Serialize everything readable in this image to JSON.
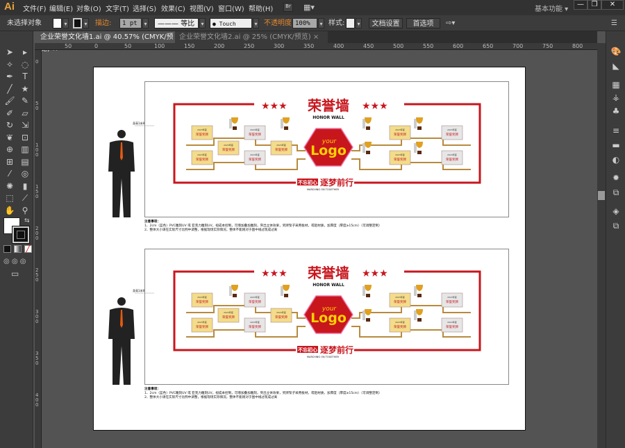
{
  "app": {
    "logo": "Ai",
    "menus": [
      "文件(F)",
      "编辑(E)",
      "对象(O)",
      "文字(T)",
      "选择(S)",
      "效果(C)",
      "视图(V)",
      "窗口(W)",
      "帮助(H)"
    ],
    "bridge": "Br",
    "workspace": "基本功能 ▾",
    "win": {
      "min": "—",
      "restore": "❐",
      "close": "✕"
    }
  },
  "control": {
    "selection": "未选择对象",
    "stroke_label": "描边:",
    "stroke_value": "1 pt",
    "profile": "等比",
    "brush": "Touch Cal..",
    "opacity_label": "不透明度",
    "opacity": "100%",
    "style_label": "样式:",
    "doc_setup": "文档设置",
    "prefs": "首选项"
  },
  "tabs": [
    {
      "label": "企业荣誉文化墙1.ai @ 40.57% (CMYK/预览)",
      "close": "×",
      "active": true
    },
    {
      "label": "企业荣誉文化墙2.ai @ 25% (CMYK/预览)",
      "close": "×",
      "active": false
    }
  ],
  "ruler": {
    "top": [
      "50",
      "0",
      "50",
      "100",
      "150",
      "200",
      "250",
      "300",
      "350",
      "400",
      "450",
      "500",
      "550",
      "600",
      "650",
      "700",
      "750",
      "800"
    ],
    "left": [
      "0",
      "50",
      "100",
      "150",
      "200",
      "250",
      "300",
      "350",
      "400"
    ]
  },
  "tools": [
    "selection",
    "direct-selection",
    "magic-wand",
    "lasso",
    "pen",
    "type",
    "line",
    "star",
    "paintbrush",
    "pencil",
    "blob-brush",
    "eraser",
    "rotate",
    "scale",
    "warp",
    "free-transform",
    "shape-builder",
    "perspective-grid",
    "mesh",
    "gradient",
    "eyedropper",
    "blend",
    "symbol-sprayer",
    "column-graph",
    "artboard",
    "slice",
    "hand",
    "zoom"
  ],
  "panels": [
    "color",
    "color-guide",
    "swatches",
    "brushes",
    "symbols",
    "stroke",
    "gradient",
    "transparency",
    "appearance",
    "graphic-styles",
    "layers",
    "artboards"
  ],
  "artwork": {
    "title": "荣誉墙",
    "subtitle": "HONOR WALL",
    "logo_small": "your",
    "logo_big": "Logo",
    "slogan_box": "不忘初心",
    "slogan": "逐梦前行",
    "slogan_en": "MARCHING ON TOGETHER",
    "plaque_year": "2023年度",
    "plaque_text": "荣誉奖牌",
    "height_label": "身高1米8",
    "colors": {
      "red": "#c8161d",
      "gold": "#b88a3c",
      "logo_text": "#ffd200"
    },
    "notes_title": "注意事项：",
    "note1": "1、2cm（蓝色）PVC雕刻UV 或 亚克力雕刻UV，视成本控制，可增加叠加雕刻，突出立体效果，奖牌架子采用板材，或铝材质，加厚度（厚度≥15cm）（可调整定制）",
    "note2": "2、整体大小请在实际尺寸比例中调整，根据现场实际情况，整体不能刚对于图中线过现成过离"
  }
}
